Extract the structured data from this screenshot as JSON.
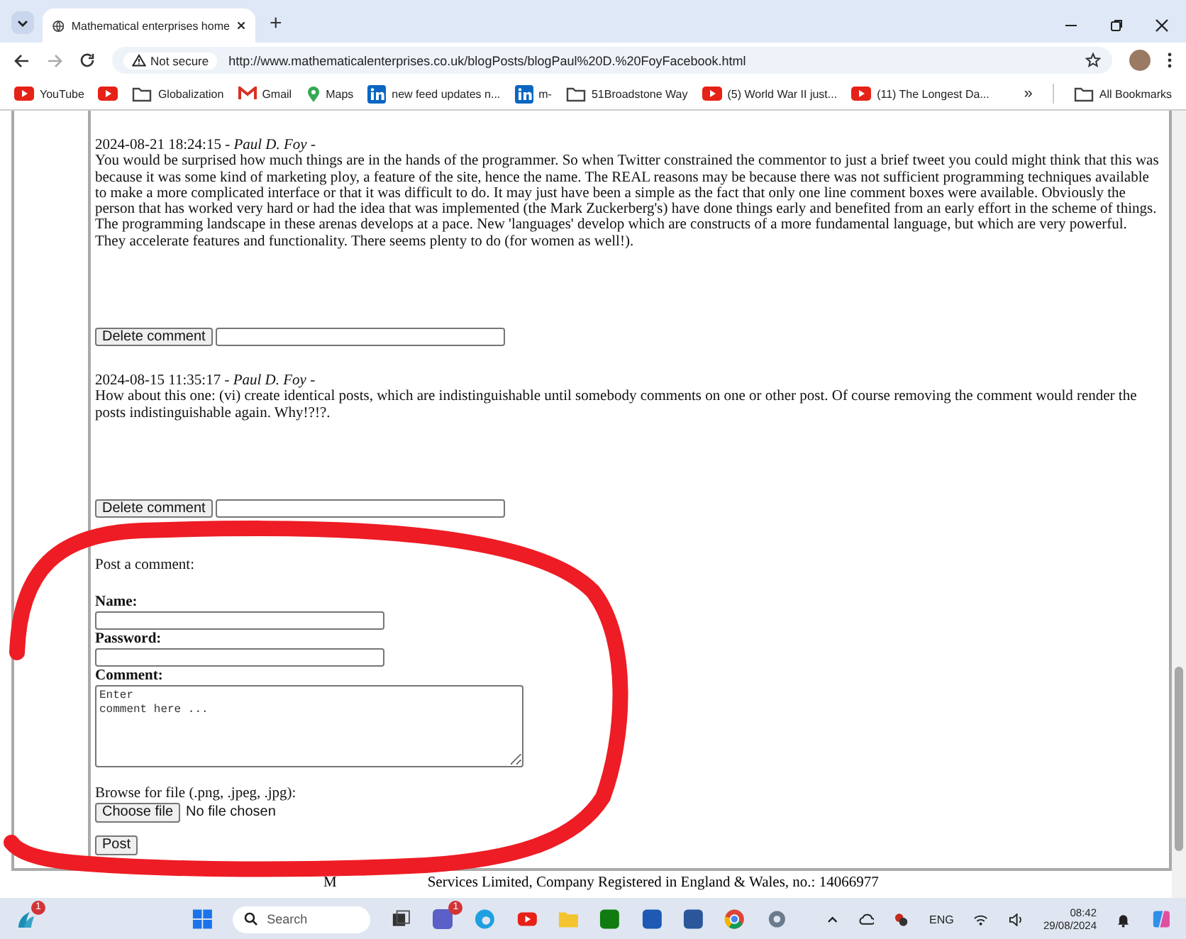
{
  "browser": {
    "tab_title": "Mathematical enterprises home",
    "new_tab": "+",
    "security": "Not secure",
    "url": "http://www.mathematicalenterprises.co.uk/blogPosts/blogPaul%20D.%20FoyFacebook.html",
    "bookmarks": [
      {
        "kind": "youtube",
        "label": "YouTube"
      },
      {
        "kind": "youtube"
      },
      {
        "kind": "folder",
        "label": "Globalization"
      },
      {
        "kind": "gmail",
        "label": "Gmail"
      },
      {
        "kind": "maps",
        "label": "Maps"
      },
      {
        "kind": "linkedin",
        "label": "new feed updates n..."
      },
      {
        "kind": "linkedin",
        "label": "m-"
      },
      {
        "kind": "folder",
        "label": "51Broadstone Way"
      },
      {
        "kind": "youtube",
        "label": "(5) World War II just..."
      },
      {
        "kind": "youtube",
        "label": "(11) The Longest Da..."
      }
    ],
    "more_bookmarks": "»",
    "all_bookmarks": "All Bookmarks"
  },
  "comments": [
    {
      "header": "2024-08-21 18:24:15 - *Paul D. Foy* -",
      "body": "You would be surprised how much things are in the hands of the programmer. So when Twitter constrained the commentor to just a brief tweet you could might think that this was because it was some kind of marketing ploy, a feature of the site, hence the name. The REAL reasons may be because there was not sufficient programming techniques available to make a more complicated interface or that it was difficult to do. It may just have been a simple as the fact that only one line comment boxes were available. Obviously the person that has worked very hard or had the idea that was implemented (the Mark Zuckerberg's) have done things early and benefited from an early effort in the scheme of things. The programming landscape in these arenas develops at a pace. New 'languages' develop which are constructs of a more fundamental language, but which are very powerful. They accelerate features and functionality. There seems plenty to do (for women as well!).",
      "delete_label": "Delete comment"
    },
    {
      "header": "2024-08-15 11:35:17 - *Paul D. Foy* -",
      "body": "How about this one: (vi) create identical posts, which are indistinguishable until somebody comments on one or other post. Of course removing the comment would render the posts indistinguishable again. Why!?!?.",
      "delete_label": "Delete comment"
    }
  ],
  "form": {
    "heading": "Post a comment:",
    "name_label": "Name:",
    "password_label": "Password:",
    "comment_label": "Comment:",
    "comment_value": "Enter\ncomment here ...",
    "browse_label": "Browse for file (.png, .jpeg, .jpg):",
    "choose_file": "Choose file",
    "no_file": "No file chosen",
    "post": "Post"
  },
  "footer": {
    "prefix": "M",
    "text": "Services Limited, Company Registered in England & Wales, no.: 14066977"
  },
  "taskbar": {
    "weather_badge": "1",
    "search_placeholder": "Search",
    "teams_badge": "1",
    "language": "ENG",
    "time": "08:42",
    "date": "29/08/2024"
  }
}
